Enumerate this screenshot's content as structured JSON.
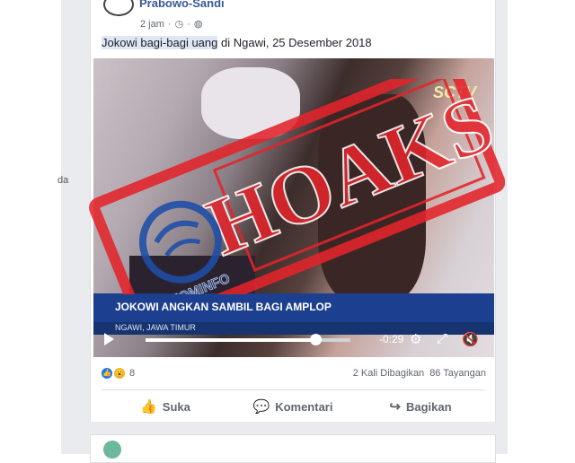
{
  "sidebar_fragment": "da",
  "post": {
    "author": "Prabowo-Sandi",
    "time": "2 jam",
    "meta_icons": [
      "clock-icon",
      "globe-icon"
    ],
    "caption_highlight": "Jokowi bagi-bagi uang",
    "caption_rest": " di Ngawi, 25 Desember 2018"
  },
  "video": {
    "channel": "SCTV",
    "lower_third_title": "JOKOWI ANGKAN SAMBIL BAGI AMPLOP",
    "lower_third_sub": "NGAWI, JAWA TIMUR",
    "time_remaining": "-0:29",
    "progress": 0.83
  },
  "stamp": {
    "text": "HOAKS",
    "logo_text": "KOMINFO",
    "color": "#e3242b"
  },
  "engagement": {
    "reactions": [
      "like",
      "wow"
    ],
    "reaction_count": "8",
    "shares": "2 Kali Dibagikan",
    "views": "86 Tayangan"
  },
  "actions": {
    "like": "Suka",
    "comment": "Komentari",
    "share": "Bagikan"
  }
}
